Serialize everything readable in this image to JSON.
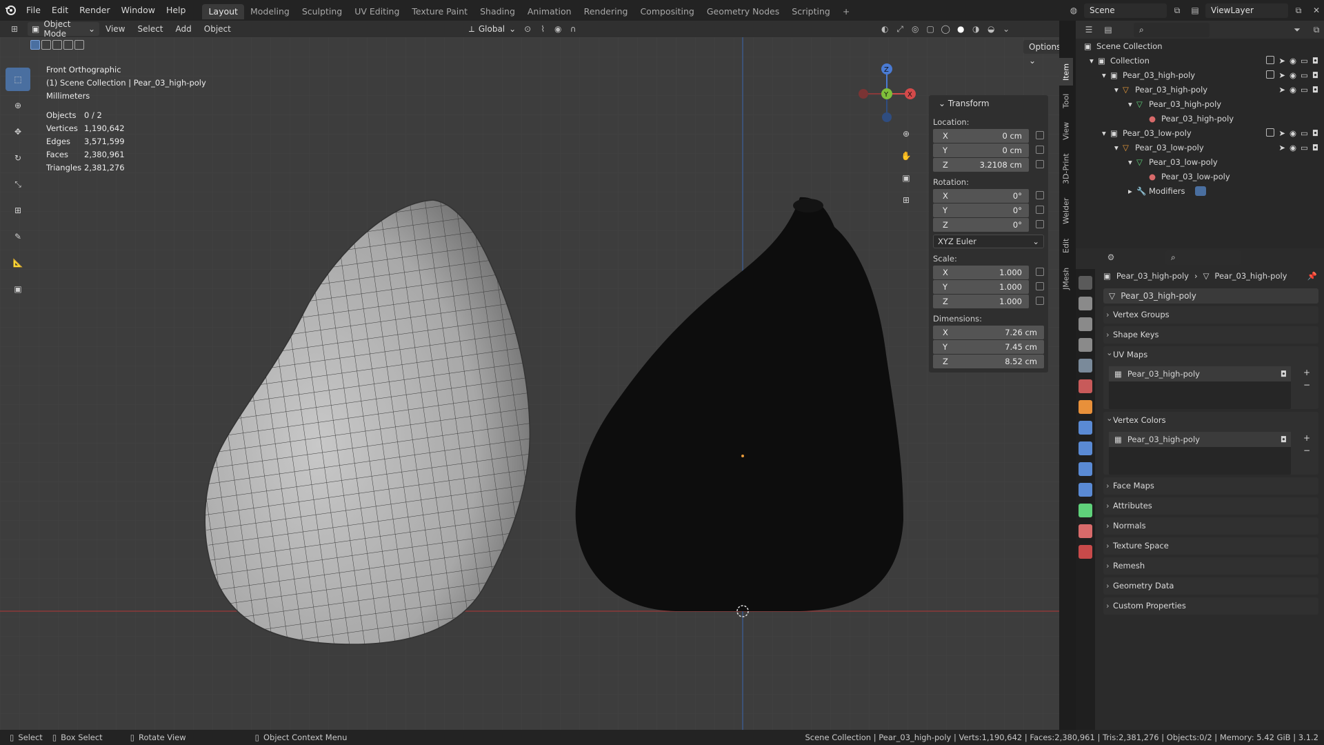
{
  "topbar": {
    "menus": [
      "File",
      "Edit",
      "Render",
      "Window",
      "Help"
    ],
    "workspaces": [
      "Layout",
      "Modeling",
      "Sculpting",
      "UV Editing",
      "Texture Paint",
      "Shading",
      "Animation",
      "Rendering",
      "Compositing",
      "Geometry Nodes",
      "Scripting"
    ],
    "active_workspace": "Layout",
    "scene": "Scene",
    "view_layer": "ViewLayer"
  },
  "viewport_header": {
    "mode": "Object Mode",
    "menus": [
      "View",
      "Select",
      "Add",
      "Object"
    ],
    "orientation": "Global",
    "options": "Options"
  },
  "viewport": {
    "view_name": "Front Orthographic",
    "collection_path": "(1) Scene Collection | Pear_03_high-poly",
    "units": "Millimeters",
    "stats": [
      {
        "label": "Objects",
        "value": "0 / 2"
      },
      {
        "label": "Vertices",
        "value": "1,190,642"
      },
      {
        "label": "Edges",
        "value": "3,571,599"
      },
      {
        "label": "Faces",
        "value": "2,380,961"
      },
      {
        "label": "Triangles",
        "value": "2,381,276"
      }
    ],
    "gizmo": {
      "x": "X",
      "y": "Y",
      "z": "Z"
    }
  },
  "transform": {
    "title": "Transform",
    "location_label": "Location:",
    "location": [
      {
        "axis": "X",
        "value": "0 cm"
      },
      {
        "axis": "Y",
        "value": "0 cm"
      },
      {
        "axis": "Z",
        "value": "3.2108 cm"
      }
    ],
    "rotation_label": "Rotation:",
    "rotation": [
      {
        "axis": "X",
        "value": "0°"
      },
      {
        "axis": "Y",
        "value": "0°"
      },
      {
        "axis": "Z",
        "value": "0°"
      }
    ],
    "rotation_mode": "XYZ Euler",
    "scale_label": "Scale:",
    "scale": [
      {
        "axis": "X",
        "value": "1.000"
      },
      {
        "axis": "Y",
        "value": "1.000"
      },
      {
        "axis": "Z",
        "value": "1.000"
      }
    ],
    "dimensions_label": "Dimensions:",
    "dimensions": [
      {
        "axis": "X",
        "value": "7.26 cm"
      },
      {
        "axis": "Y",
        "value": "7.45 cm"
      },
      {
        "axis": "Z",
        "value": "8.52 cm"
      }
    ]
  },
  "sidebar_tabs": [
    "Item",
    "Tool",
    "View",
    "3D-Print",
    "Welder",
    "Edit",
    "JMesh"
  ],
  "outliner": {
    "rows": [
      {
        "label": "Scene Collection",
        "indent": 0
      },
      {
        "label": "Collection",
        "indent": 1
      },
      {
        "label": "Pear_03_high-poly",
        "indent": 2
      },
      {
        "label": "Pear_03_high-poly",
        "indent": 3
      },
      {
        "label": "Pear_03_high-poly",
        "indent": 4
      },
      {
        "label": "Pear_03_high-poly",
        "indent": 5
      },
      {
        "label": "Pear_03_low-poly",
        "indent": 2
      },
      {
        "label": "Pear_03_low-poly",
        "indent": 3
      },
      {
        "label": "Pear_03_low-poly",
        "indent": 4
      },
      {
        "label": "Pear_03_low-poly",
        "indent": 5
      },
      {
        "label": "Modifiers",
        "indent": 4
      }
    ]
  },
  "properties": {
    "breadcrumb_object": "Pear_03_high-poly",
    "breadcrumb_mesh": "Pear_03_high-poly",
    "mesh_name": "Pear_03_high-poly",
    "panels": {
      "vertex_groups": "Vertex Groups",
      "shape_keys": "Shape Keys",
      "uv_maps": "UV Maps",
      "uv_map_item": "Pear_03_high-poly",
      "vertex_colors": "Vertex Colors",
      "vertex_color_item": "Pear_03_high-poly",
      "face_maps": "Face Maps",
      "attributes": "Attributes",
      "normals": "Normals",
      "texture_space": "Texture Space",
      "remesh": "Remesh",
      "geometry_data": "Geometry Data",
      "custom_properties": "Custom Properties"
    }
  },
  "statusbar": {
    "select": "Select",
    "box_select": "Box Select",
    "rotate_view": "Rotate View",
    "context_menu": "Object Context Menu",
    "info": "Scene Collection | Pear_03_high-poly | Verts:1,190,642 | Faces:2,380,961 | Tris:2,381,276 | Objects:0/2 | Memory: 5.42 GiB | 3.1.2"
  }
}
